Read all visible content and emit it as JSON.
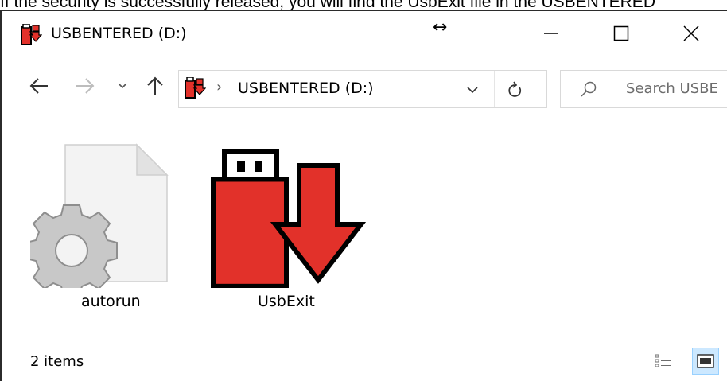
{
  "caption": "If the security is successfully released, you will find the UsbExit file in the USBENTERED",
  "window": {
    "title": "USBENTERED (D:)",
    "resize_cursor_glyph": "↔",
    "controls": {
      "minimize_icon": "minimize-icon",
      "maximize_icon": "maximize-icon",
      "close_icon": "close-icon"
    }
  },
  "nav": {
    "back_icon": "arrow-left-icon",
    "forward_icon": "arrow-right-icon",
    "recent_icon": "chevron-down-icon",
    "up_icon": "arrow-up-icon",
    "address": {
      "separator": "›",
      "path": "USBENTERED (D:)",
      "dropdown_icon": "chevron-down-icon",
      "refresh_icon": "refresh-icon"
    },
    "search": {
      "placeholder": "Search USBE",
      "icon": "search-icon"
    }
  },
  "files": [
    {
      "name": "autorun",
      "icon": "settings-file-icon"
    },
    {
      "name": "UsbExit",
      "icon": "usb-eject-icon"
    }
  ],
  "status": {
    "item_count": "2 items",
    "views": [
      "details-view",
      "large-icons-view"
    ],
    "active_view": "large-icons-view"
  },
  "colors": {
    "usb_red": "#e2312a",
    "accent_selected": "#cce8ff",
    "accent_border": "#99d1ff"
  }
}
